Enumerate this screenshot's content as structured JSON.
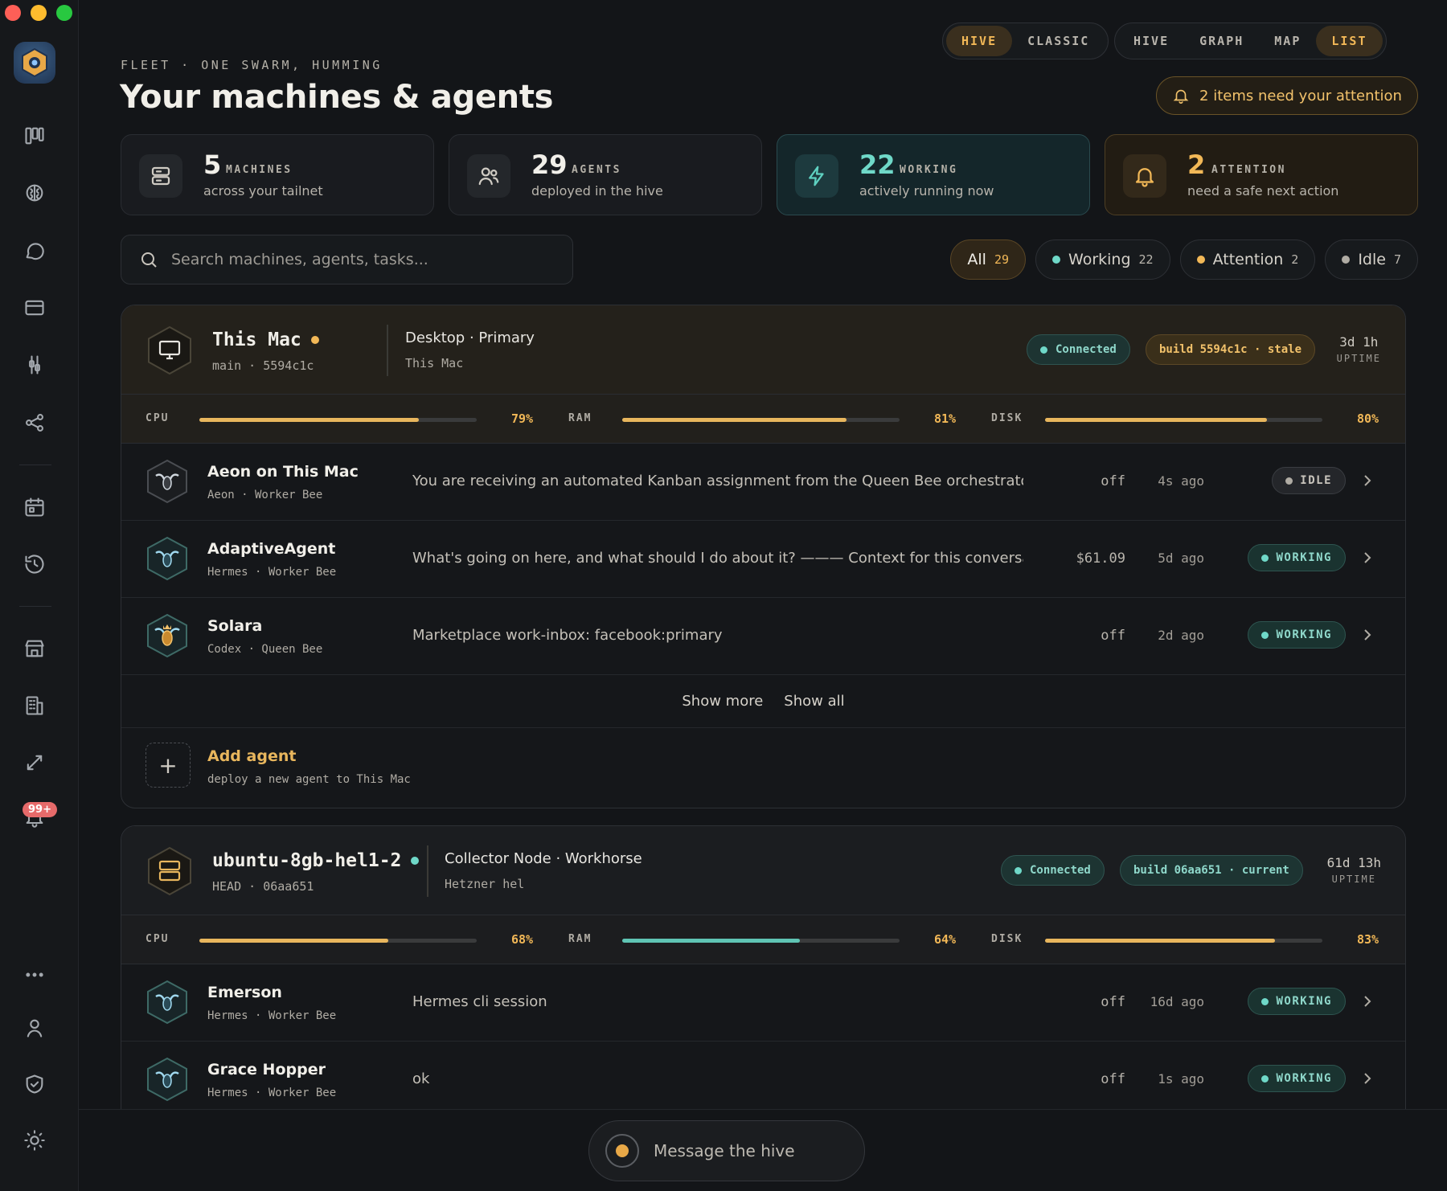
{
  "header": {
    "eyebrow": "FLEET · ONE SWARM, HUMMING",
    "title": "Your machines & agents",
    "mode_toggle": [
      "HIVE",
      "CLASSIC"
    ],
    "mode_active": "HIVE",
    "view_toggle": [
      "HIVE",
      "GRAPH",
      "MAP",
      "LIST"
    ],
    "view_active": "LIST",
    "attention_notice": "2 items need your attention"
  },
  "sidebar": {
    "notification_badge": "99+"
  },
  "stats": [
    {
      "value": "5",
      "label": "MACHINES",
      "sub": "across your tailnet",
      "icon": "server-icon"
    },
    {
      "value": "29",
      "label": "AGENTS",
      "sub": "deployed in the hive",
      "icon": "users-icon"
    },
    {
      "value": "22",
      "label": "WORKING",
      "sub": "actively running now",
      "icon": "bolt-icon"
    },
    {
      "value": "2",
      "label": "ATTENTION",
      "sub": "need a safe next action",
      "icon": "bell-icon"
    }
  ],
  "search": {
    "placeholder": "Search machines, agents, tasks..."
  },
  "filters": [
    {
      "label": "All",
      "count": "29"
    },
    {
      "label": "Working",
      "count": "22"
    },
    {
      "label": "Attention",
      "count": "2"
    },
    {
      "label": "Idle",
      "count": "7"
    }
  ],
  "machines": [
    {
      "name": "This Mac",
      "sub": "main · 5594c1c",
      "role": "Desktop · Primary",
      "location": "This Mac",
      "connection": "Connected",
      "build": "build 5594c1c · stale",
      "uptime": "3d 1h",
      "uptime_label": "UPTIME",
      "cpu_label": "CPU",
      "cpu": "79%",
      "ram_label": "RAM",
      "ram": "81%",
      "disk_label": "DISK",
      "disk": "80%",
      "agents": [
        {
          "name": "Aeon on This Mac",
          "sub": "Aeon · Worker Bee",
          "task": "You are receiving an automated Kanban assignment from the Queen Bee orchestrator. T...",
          "cost": "off",
          "time": "4s ago",
          "status": "IDLE"
        },
        {
          "name": "AdaptiveAgent",
          "sub": "Hermes · Worker Bee",
          "task": "What's going on here, and what should I do about it? ——— Context for this conversation..",
          "cost": "$61.09",
          "time": "5d ago",
          "status": "WORKING"
        },
        {
          "name": "Solara",
          "sub": "Codex · Queen Bee",
          "task": "Marketplace work-inbox: facebook:primary",
          "cost": "off",
          "time": "2d ago",
          "status": "WORKING"
        }
      ],
      "show_more": "Show more",
      "show_all": "Show all",
      "add_agent": "Add agent",
      "add_agent_sub": "deploy a new agent to This Mac"
    },
    {
      "name": "ubuntu-8gb-hel1-2",
      "sub": "HEAD · 06aa651",
      "role": "Collector Node · Workhorse",
      "location": "Hetzner hel",
      "connection": "Connected",
      "build": "build 06aa651 · current",
      "uptime": "61d 13h",
      "uptime_label": "UPTIME",
      "cpu_label": "CPU",
      "cpu": "68%",
      "ram_label": "RAM",
      "ram": "64%",
      "disk_label": "DISK",
      "disk": "83%",
      "agents": [
        {
          "name": "Emerson",
          "sub": "Hermes · Worker Bee",
          "task": "Hermes cli session",
          "cost": "off",
          "time": "16d ago",
          "status": "WORKING"
        },
        {
          "name": "Grace Hopper",
          "sub": "Hermes · Worker Bee",
          "task": "ok",
          "cost": "off",
          "time": "1s ago",
          "status": "WORKING"
        }
      ]
    }
  ],
  "composer": {
    "placeholder": "Message the hive"
  },
  "colors": {
    "accent": "#f2b857",
    "teal": "#5fc4b4",
    "background": "#131518"
  }
}
